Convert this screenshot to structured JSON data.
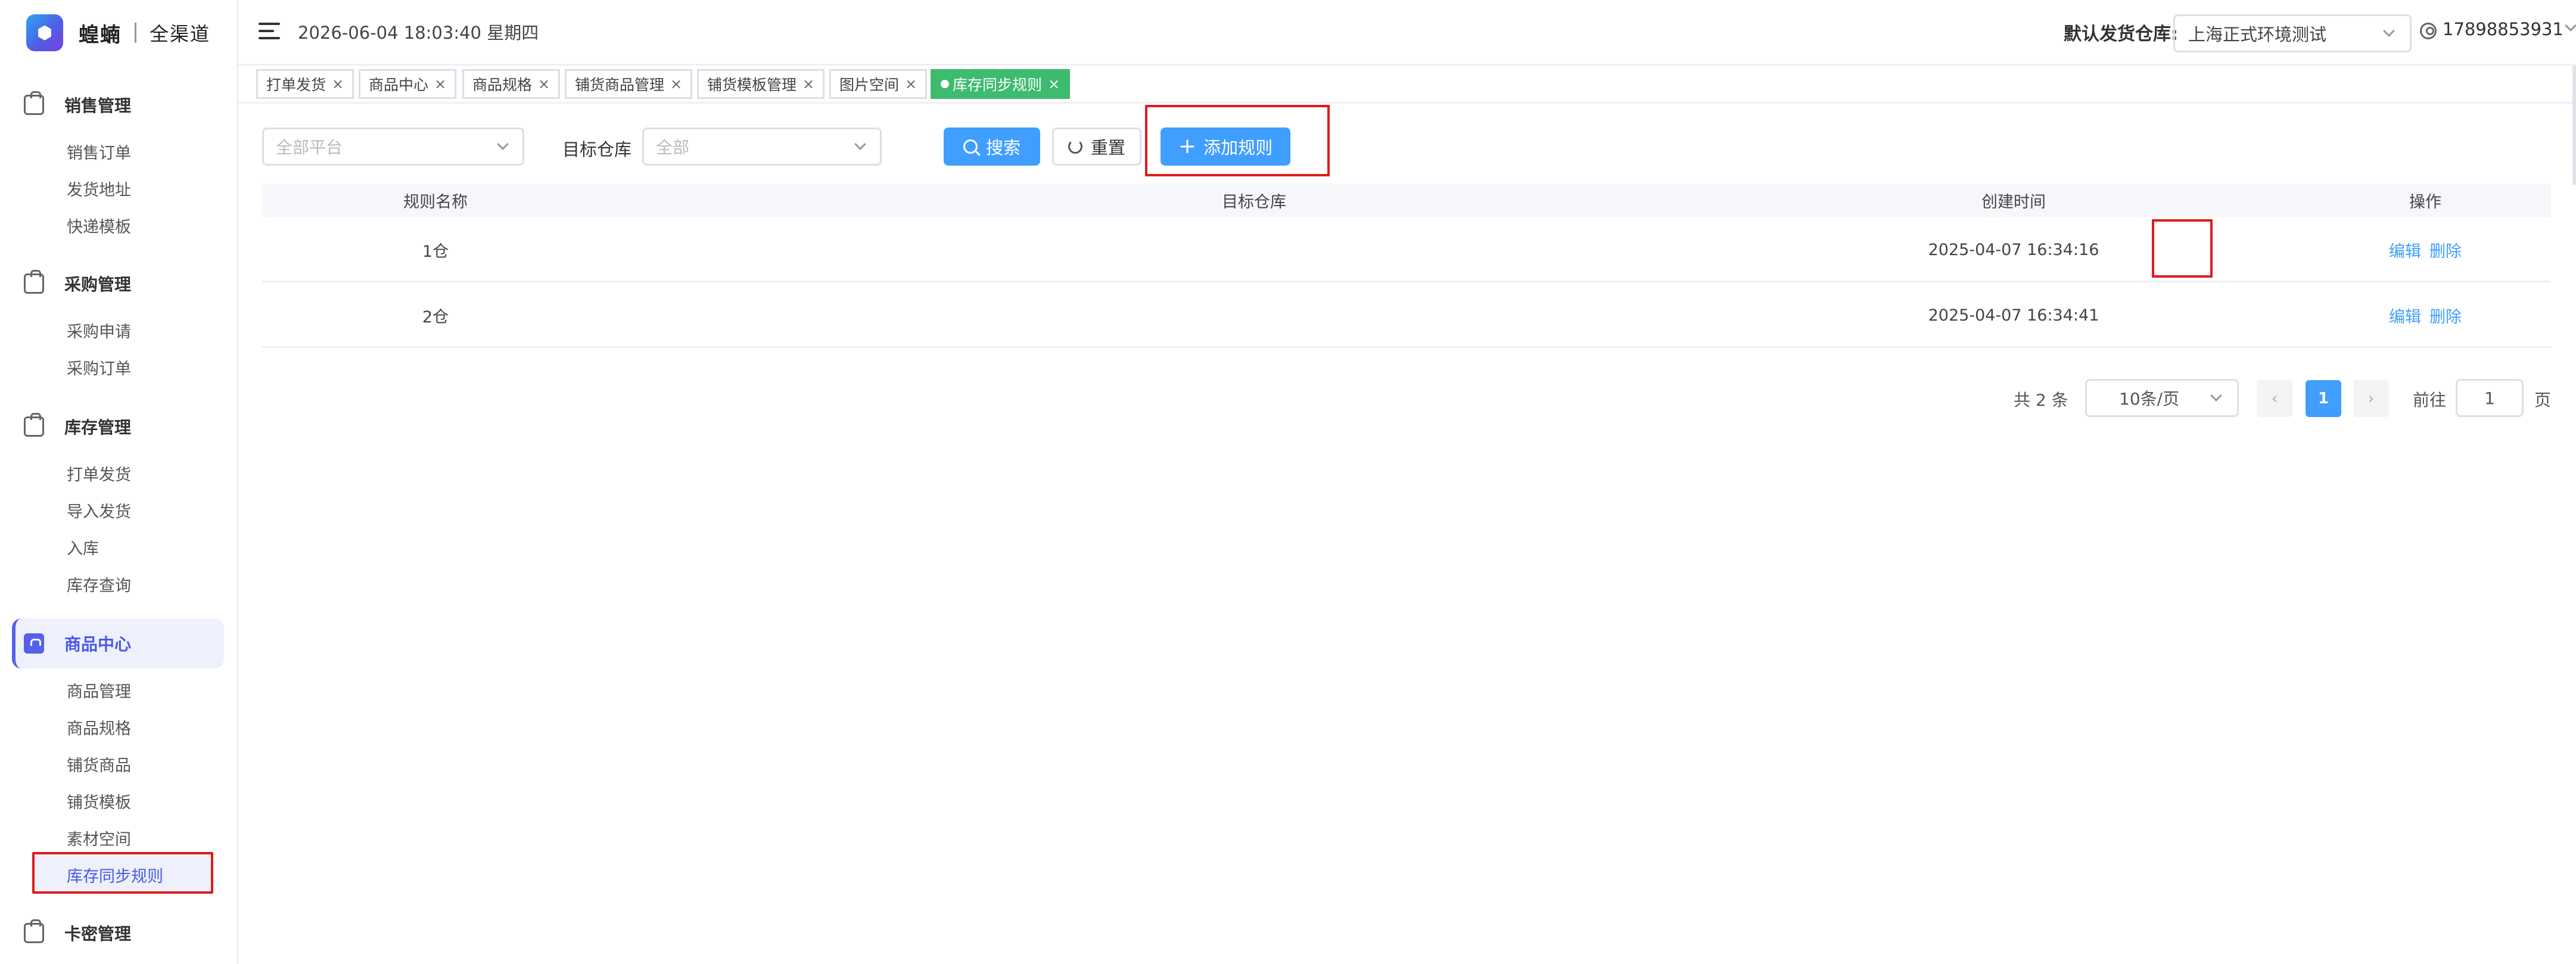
{
  "brand": {
    "name": "蝗蝻",
    "sub": "全渠道"
  },
  "sidebar": {
    "groups": [
      {
        "title": "销售管理",
        "items": [
          "销售订单",
          "发货地址",
          "快递模板"
        ]
      },
      {
        "title": "采购管理",
        "items": [
          "采购申请",
          "采购订单"
        ]
      },
      {
        "title": "库存管理",
        "items": [
          "打单发货",
          "导入发货",
          "入库",
          "库存查询"
        ]
      },
      {
        "title": "商品中心",
        "items": [
          "商品管理",
          "商品规格",
          "铺货商品",
          "铺货模板",
          "素材空间",
          "库存同步规则"
        ]
      },
      {
        "title": "卡密管理",
        "items": []
      }
    ]
  },
  "header": {
    "datetime": "2026-06-04 18:03:40 星期四",
    "warehouse_label": "默认发货仓库:",
    "warehouse_value": "上海正式环境测试",
    "user": "17898853931"
  },
  "tags": [
    {
      "label": "打单发货"
    },
    {
      "label": "商品中心"
    },
    {
      "label": "商品规格"
    },
    {
      "label": "铺货商品管理"
    },
    {
      "label": "铺货模板管理"
    },
    {
      "label": "图片空间"
    },
    {
      "label": "库存同步规则"
    }
  ],
  "filters": {
    "platform_placeholder": "全部平台",
    "warehouse_label": "目标仓库",
    "warehouse_placeholder": "全部",
    "search": "搜索",
    "reset": "重置",
    "add": "添加规则"
  },
  "table": {
    "headers": {
      "name": "规则名称",
      "warehouse": "目标仓库",
      "created": "创建时间",
      "ops": "操作"
    },
    "rows": [
      {
        "name": "1仓",
        "warehouse": "",
        "created": "2025-04-07 16:34:16",
        "edit": "编辑",
        "delete": "删除"
      },
      {
        "name": "2仓",
        "warehouse": "",
        "created": "2025-04-07 16:34:41",
        "edit": "编辑",
        "delete": "删除"
      }
    ]
  },
  "pagination": {
    "total": "共 2 条",
    "page_size": "10条/页",
    "prev": "‹",
    "current": "1",
    "next": "›",
    "goto_label": "前往",
    "goto_value": "1",
    "page_suffix": "页"
  }
}
